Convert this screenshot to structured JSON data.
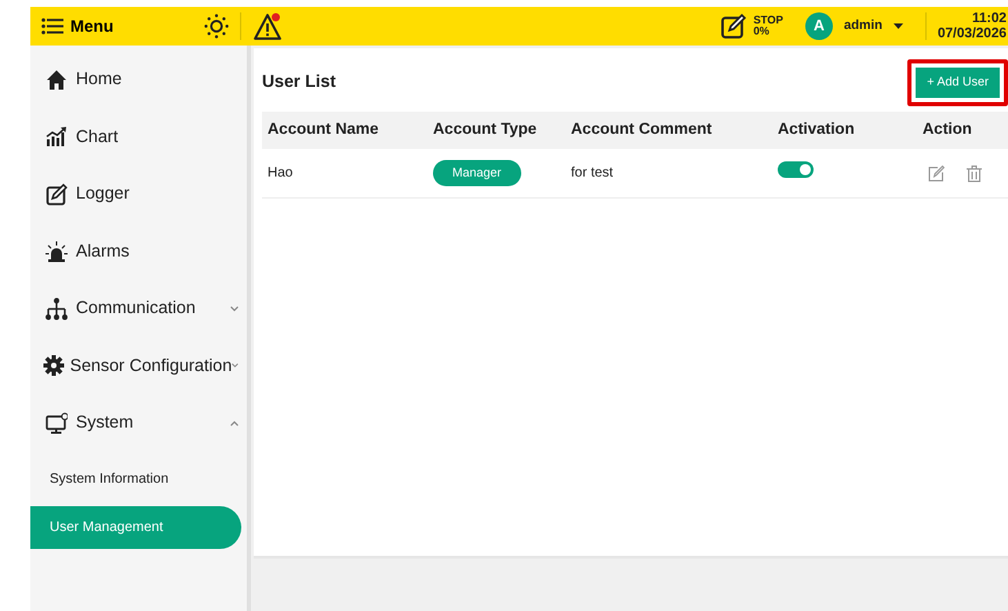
{
  "header": {
    "menu_label": "Menu",
    "alert_active": true,
    "status": {
      "line_1": "STOP",
      "line_2": "0%"
    },
    "user": {
      "avatar": "A",
      "name": "admin"
    },
    "time": "11:02",
    "date": "07/03/2026"
  },
  "sidebar": {
    "items": [
      {
        "label": "Home",
        "kind": "link"
      },
      {
        "label": "Chart",
        "kind": "link"
      },
      {
        "label": "Logger",
        "kind": "link"
      },
      {
        "label": "Alarms",
        "kind": "link"
      },
      {
        "label": "Communication",
        "kind": "group",
        "expanded": false
      },
      {
        "label": "Sensor Configuration",
        "kind": "group",
        "expanded": false
      },
      {
        "label": "System",
        "kind": "group",
        "expanded": true,
        "children": [
          {
            "label": "System Information",
            "selected": false
          },
          {
            "label": "User Management",
            "selected": true
          }
        ]
      }
    ]
  },
  "panel": {
    "title": "User List",
    "add_button": {
      "label": "+ Add User",
      "highlighted": true
    },
    "table": {
      "columns": [
        "Account Name",
        "Account Type",
        "Account Comment",
        "Activation",
        "Action"
      ],
      "rows": [
        {
          "name": "Hao",
          "type": "Manager",
          "comment": "for test",
          "active": true
        }
      ]
    }
  }
}
